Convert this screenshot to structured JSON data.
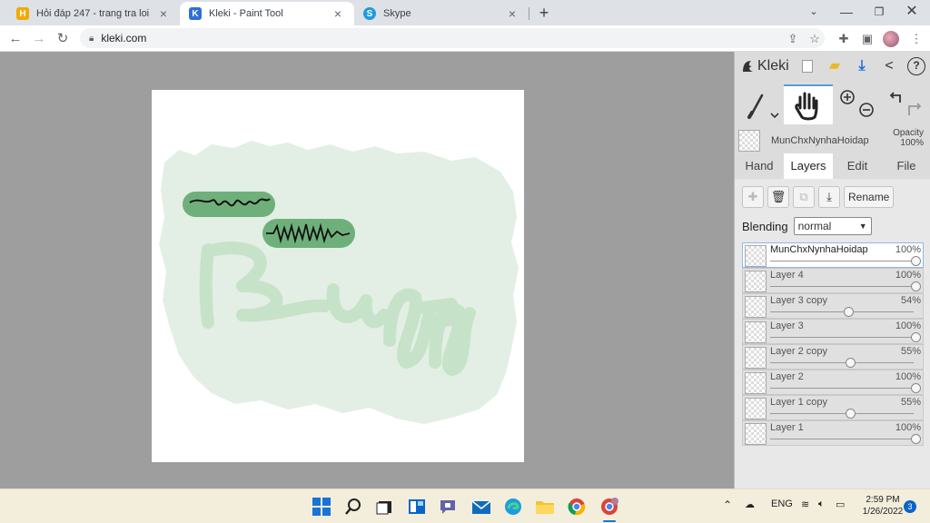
{
  "browser": {
    "tabs": [
      {
        "title": "Hỏi đáp 247 - trang tra loi",
        "favicon": "hoidap-icon",
        "active": false
      },
      {
        "title": "Kleki - Paint Tool",
        "favicon": "kleki-icon",
        "active": true
      },
      {
        "title": "Skype",
        "favicon": "skype-icon",
        "active": false
      }
    ],
    "close_glyph": "×",
    "new_tab_glyph": "+",
    "url": "kleki.com"
  },
  "app": {
    "logo_text": "Kleki",
    "current_layer": {
      "name": "MunChxNynhaHoidap",
      "opacity_label": "Opacity",
      "opacity_value": "100%"
    },
    "panel_tabs": [
      "Hand",
      "Layers",
      "Edit",
      "File"
    ],
    "active_tab": "Layers",
    "rename_label": "Rename",
    "blending_label": "Blending",
    "blending_value": "normal",
    "layers": [
      {
        "name": "MunChxNynhaHoidap",
        "opacity": "100%",
        "value": 1.0,
        "selected": true
      },
      {
        "name": "Layer 4",
        "opacity": "100%",
        "value": 1.0,
        "selected": false
      },
      {
        "name": "Layer 3 copy",
        "opacity": "54%",
        "value": 0.54,
        "selected": false
      },
      {
        "name": "Layer 3",
        "opacity": "100%",
        "value": 1.0,
        "selected": false
      },
      {
        "name": "Layer 2 copy",
        "opacity": "55%",
        "value": 0.55,
        "selected": false
      },
      {
        "name": "Layer 2",
        "opacity": "100%",
        "value": 1.0,
        "selected": false
      },
      {
        "name": "Layer 1 copy",
        "opacity": "55%",
        "value": 0.55,
        "selected": false
      },
      {
        "name": "Layer 1",
        "opacity": "100%",
        "value": 1.0,
        "selected": false
      }
    ]
  },
  "taskbar": {
    "language": "ENG",
    "time": "2:59 PM",
    "date": "1/26/2022",
    "notifications": "3"
  },
  "colors": {
    "accent": "#5b9bd5",
    "canvas_bg": "#9e9e9e",
    "paint_light": "#e3efe4",
    "paint_green": "#c6e3c9",
    "sticker_green": "#6fb07a"
  }
}
